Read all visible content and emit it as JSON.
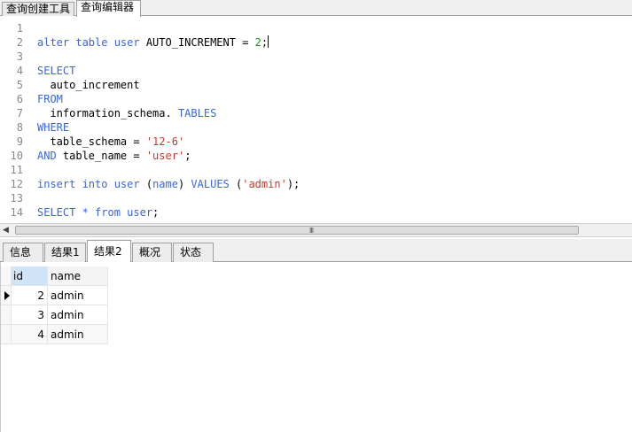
{
  "top_tabs": [
    "查询创建工具",
    "查询编辑器"
  ],
  "editor": {
    "lines": [
      {
        "n": "1",
        "segs": []
      },
      {
        "n": "2",
        "segs": [
          {
            "t": "alter table user ",
            "c": "kw"
          },
          {
            "t": "AUTO_INCREMENT = ",
            "c": ""
          },
          {
            "t": "2",
            "c": "num"
          },
          {
            "t": ";",
            "c": ""
          }
        ],
        "caret": true
      },
      {
        "n": "3",
        "segs": []
      },
      {
        "n": "4",
        "segs": [
          {
            "t": "SELECT",
            "c": "kw"
          }
        ]
      },
      {
        "n": "5",
        "segs": [
          {
            "t": "  auto_increment",
            "c": ""
          }
        ]
      },
      {
        "n": "6",
        "segs": [
          {
            "t": "FROM",
            "c": "kw"
          }
        ]
      },
      {
        "n": "7",
        "segs": [
          {
            "t": "  information_schema. ",
            "c": ""
          },
          {
            "t": "TABLES",
            "c": "kw"
          }
        ]
      },
      {
        "n": "8",
        "segs": [
          {
            "t": "WHERE",
            "c": "kw"
          }
        ]
      },
      {
        "n": "9",
        "segs": [
          {
            "t": "  table_schema = ",
            "c": ""
          },
          {
            "t": "'12-6'",
            "c": "str"
          }
        ]
      },
      {
        "n": "10",
        "segs": [
          {
            "t": "AND ",
            "c": "kw"
          },
          {
            "t": "table_name = ",
            "c": ""
          },
          {
            "t": "'user'",
            "c": "str"
          },
          {
            "t": ";",
            "c": ""
          }
        ]
      },
      {
        "n": "11",
        "segs": []
      },
      {
        "n": "12",
        "segs": [
          {
            "t": "insert into user ",
            "c": "kw"
          },
          {
            "t": "(",
            "c": ""
          },
          {
            "t": "name",
            "c": "kw"
          },
          {
            "t": ") ",
            "c": ""
          },
          {
            "t": "VALUES ",
            "c": "kw"
          },
          {
            "t": "(",
            "c": ""
          },
          {
            "t": "'admin'",
            "c": "str"
          },
          {
            "t": ");",
            "c": ""
          }
        ]
      },
      {
        "n": "13",
        "segs": []
      },
      {
        "n": "14",
        "segs": [
          {
            "t": "SELECT * from user",
            "c": "kw"
          },
          {
            "t": ";",
            "c": ""
          }
        ]
      }
    ]
  },
  "scrollbar": {
    "grip": "III"
  },
  "result_tabs": [
    "信息",
    "结果1",
    "结果2",
    "概况",
    "状态"
  ],
  "result_tab_selected": "结果2",
  "grid": {
    "columns": [
      "id",
      "name"
    ],
    "rows": [
      [
        "2",
        "admin"
      ],
      [
        "3",
        "admin"
      ],
      [
        "4",
        "admin"
      ]
    ]
  }
}
